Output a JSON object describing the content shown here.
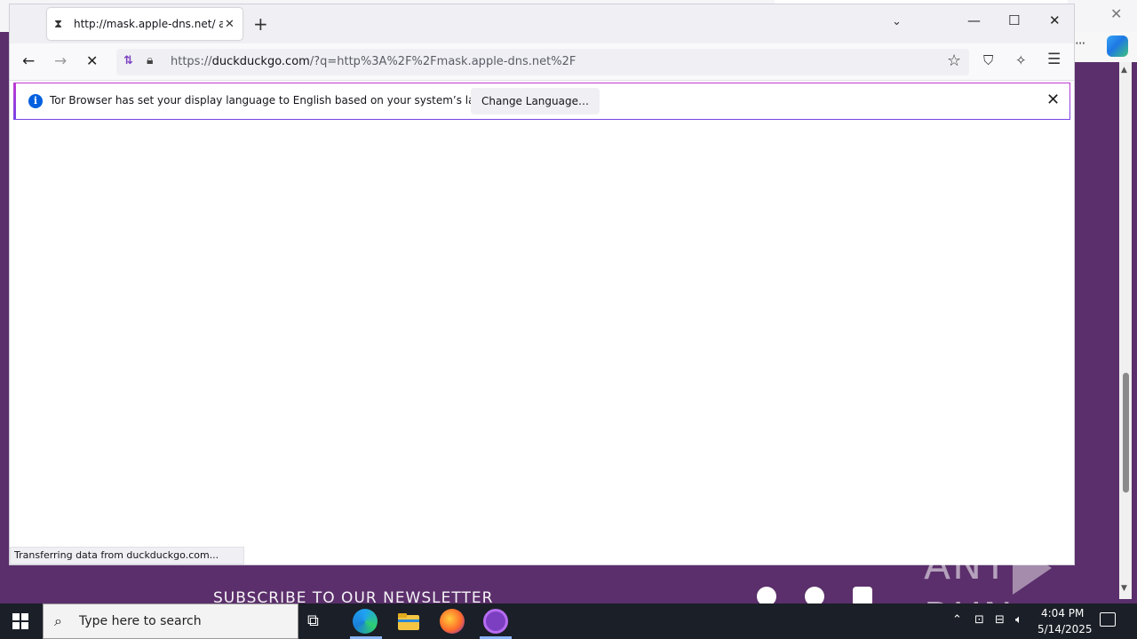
{
  "browser": {
    "tab": {
      "title": "http://mask.apple-dns.net/ at DuckDuckGo"
    },
    "url": {
      "domain": "duckduckgo.com",
      "prefix": "https://",
      "rest": "/?q=http%3A%2F%2Fmask.apple-dns.net%2F"
    },
    "notification": {
      "text": "Tor Browser has set your display language to English based on your system’s language.",
      "button_label": "Change Language…"
    },
    "status_text": "Transferring data from duckduckgo.com..."
  },
  "background_page": {
    "newsletter_text": "SUBSCRIBE TO OUR NEWSLETTER"
  },
  "watermark": {
    "left": "ANY",
    "right": "RUN"
  },
  "taskbar": {
    "search_placeholder": "Type here to search",
    "time": "4:04 PM",
    "date": "5/14/2025"
  },
  "colors": {
    "accent_purple": "#5b2f6b",
    "tor_purple": "#7d3fc2",
    "taskbar_bg": "#1b1f27",
    "info_blue": "#0060df"
  }
}
